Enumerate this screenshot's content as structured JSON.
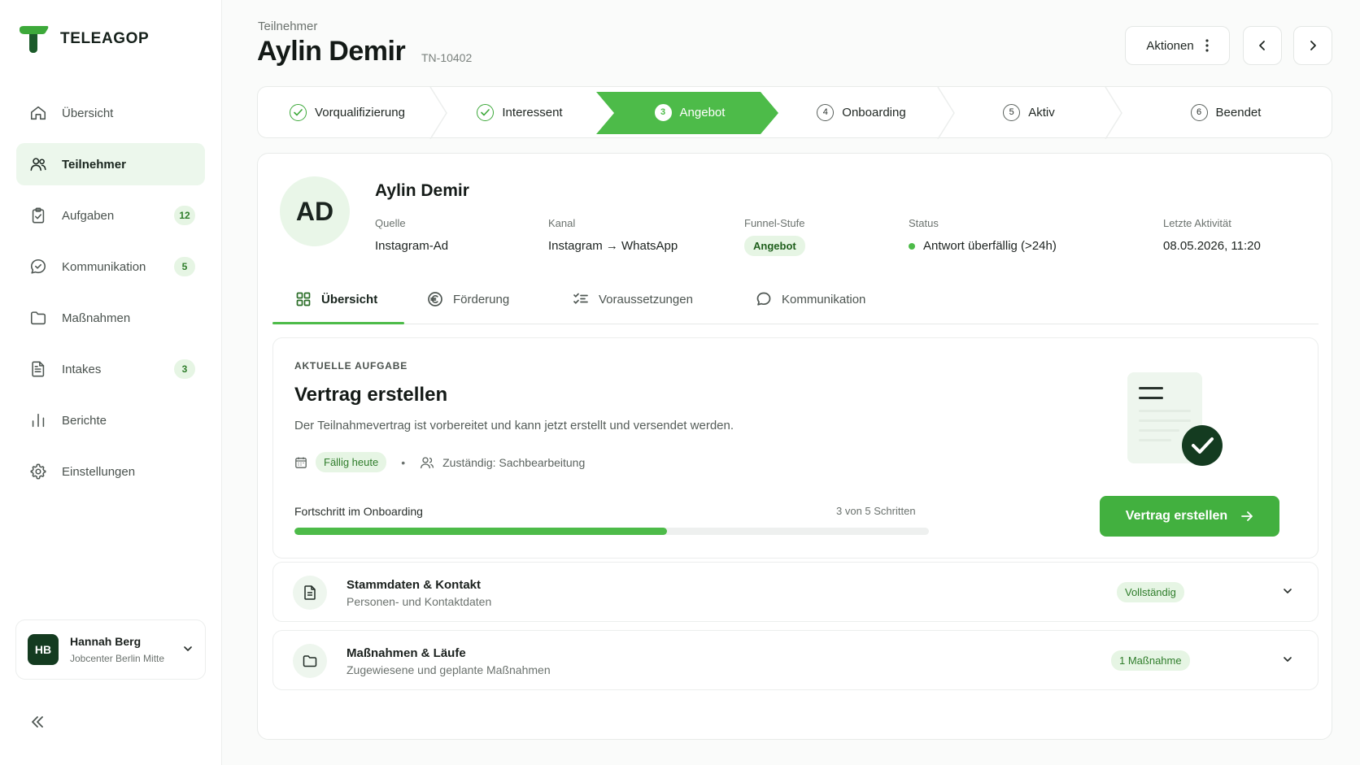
{
  "brand": {
    "name": "TELEAGOP",
    "accent": "#4dbb49",
    "dark": "#143b20"
  },
  "sidebar": {
    "items": [
      {
        "label": "Übersicht",
        "icon": "home-icon",
        "badge": ""
      },
      {
        "label": "Teilnehmer",
        "icon": "users-icon",
        "badge": "",
        "active": true
      },
      {
        "label": "Aufgaben",
        "icon": "clipboard-icon",
        "badge": "12"
      },
      {
        "label": "Kommunikation",
        "icon": "chat-icon",
        "badge": "5"
      },
      {
        "label": "Maßnahmen",
        "icon": "folder-icon",
        "badge": ""
      },
      {
        "label": "Intakes",
        "icon": "document-icon",
        "badge": "3"
      },
      {
        "label": "Berichte",
        "icon": "bar-chart-icon",
        "badge": ""
      },
      {
        "label": "Einstellungen",
        "icon": "gear-icon",
        "badge": ""
      }
    ],
    "user": {
      "initials": "HB",
      "name": "Hannah Berg",
      "org": "Jobcenter Berlin Mitte"
    }
  },
  "header": {
    "breadcrumb": "Teilnehmer",
    "title": "Aylin Demir",
    "id": "TN-10402",
    "actions_label": "Aktionen"
  },
  "stepper": {
    "steps": [
      {
        "label": "Vorqualifizierung",
        "state": "done"
      },
      {
        "label": "Interessent",
        "state": "done"
      },
      {
        "num": "3",
        "label": "Angebot",
        "state": "active"
      },
      {
        "num": "4",
        "label": "Onboarding",
        "state": "todo"
      },
      {
        "num": "5",
        "label": "Aktiv",
        "state": "todo"
      },
      {
        "num": "6",
        "label": "Beendet",
        "state": "todo"
      }
    ]
  },
  "profile": {
    "initials": "AD",
    "name": "Aylin Demir",
    "quelle_label": "Quelle",
    "quelle": "Instagram-Ad",
    "kanal_label": "Kanal",
    "kanal": "Instagram → WhatsApp",
    "funnel_label": "Funnel-Stufe",
    "funnel": "Angebot",
    "status_label": "Status",
    "status": "Antwort überfällig (>24h)",
    "activity_label": "Letzte Aktivität",
    "activity": "08.05.2026, 11:20"
  },
  "tabs": [
    {
      "label": "Übersicht",
      "icon": "grid-icon",
      "active": true
    },
    {
      "label": "Förderung",
      "icon": "euro-icon"
    },
    {
      "label": "Voraussetzungen",
      "icon": "checklist-icon"
    },
    {
      "label": "Kommunikation",
      "icon": "chat-icon"
    }
  ],
  "task": {
    "overline": "AKTUELLE AUFGABE",
    "title": "Vertrag erstellen",
    "description": "Der Teilnahmevertrag ist vorbereitet und kann jetzt erstellt und versendet werden.",
    "due": "Fällig heute",
    "assignee": "Zuständig: Sachbearbeitung",
    "progress_label": "Fortschritt im Onboarding",
    "progress_count": "3 von 5 Schritten",
    "progress_fraction": 0.587,
    "cta": "Vertrag erstellen"
  },
  "accordions": [
    {
      "title": "Stammdaten & Kontakt",
      "sub": "Personen- und Kontaktdaten",
      "badge": "Vollständig",
      "icon": "document-icon"
    },
    {
      "title": "Maßnahmen & Läufe",
      "sub": "Zugewiesene und geplante Maßnahmen",
      "badge": "1 Maßnahme",
      "icon": "folder-icon"
    }
  ]
}
